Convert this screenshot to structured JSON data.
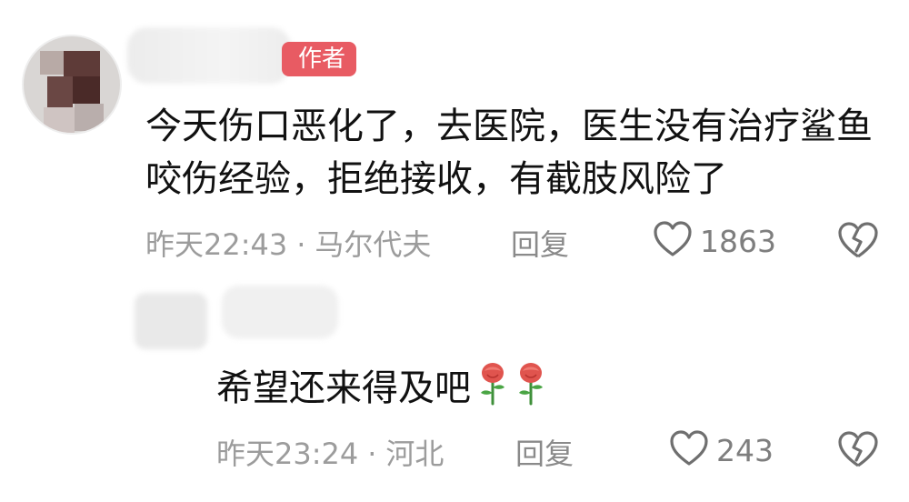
{
  "comment": {
    "author_badge": "作者",
    "text": "今天伤口恶化了，去医院，医生没有治疗鲨鱼咬伤经验，拒绝接收，有截肢风险了",
    "time": "昨天22:43",
    "location": "马尔代夫",
    "separator": "·",
    "reply_label": "回复",
    "likes": "1863",
    "like_icon": "heart-outline-icon",
    "dislike_icon": "broken-heart-icon"
  },
  "reply": {
    "text": "希望还来得及吧",
    "emojis": [
      "rose",
      "rose"
    ],
    "time": "昨天23:24",
    "location": "河北",
    "separator": "·",
    "reply_label": "回复",
    "likes": "243",
    "like_icon": "heart-outline-icon",
    "dislike_icon": "broken-heart-icon"
  },
  "colors": {
    "badge": "#e85b63",
    "meta_text": "#9c9c9c",
    "body_text": "#111111",
    "icon_stroke": "#6f6f6f"
  }
}
